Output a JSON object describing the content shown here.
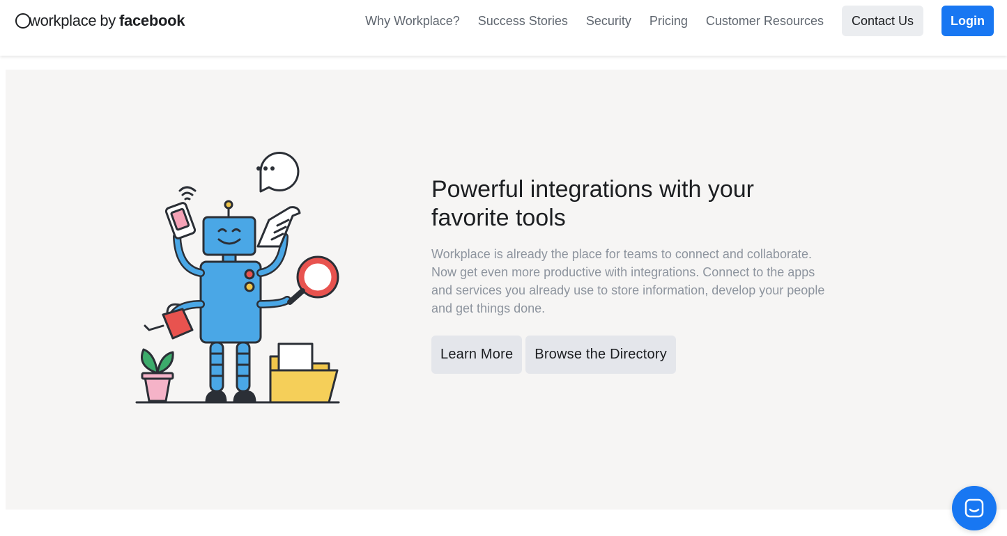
{
  "logo": {
    "word1": "workplace",
    "word2": "by",
    "word3": "facebook"
  },
  "nav": {
    "links": [
      "Why Workplace?",
      "Success Stories",
      "Security",
      "Pricing",
      "Customer Resources"
    ],
    "contact_label": "Contact Us",
    "login_label": "Login"
  },
  "hero": {
    "headline": "Powerful integrations with your favorite tools",
    "description": "Workplace is already the place for teams to connect and collaborate. Now get even more productive with integrations. Connect to the apps and services you already use to store information, develop your people and get things done.",
    "learn_more_label": "Learn More",
    "browse_label": "Browse the Directory"
  },
  "colors": {
    "brand_blue": "#1877f2",
    "hero_bg": "#f6f5f4",
    "robot_blue": "#4aa7e6"
  },
  "icons": [
    "chat-launcher-icon",
    "robot-illustration"
  ]
}
